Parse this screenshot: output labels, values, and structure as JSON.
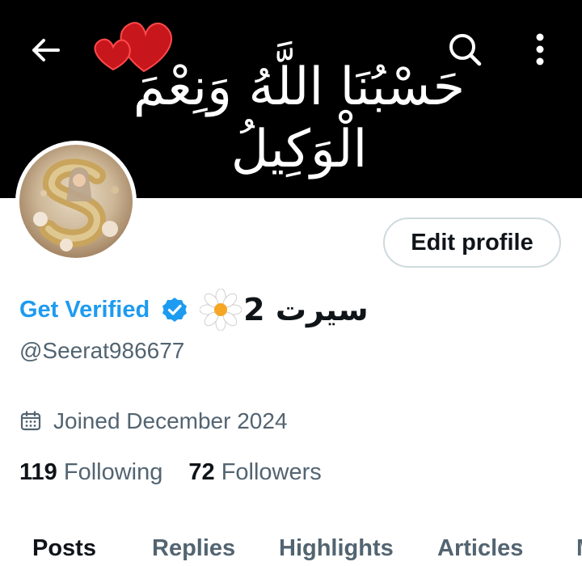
{
  "header": {
    "banner_text": "حَسْبُنَا اللَّهُ وَنِعْمَ الْوَكِيلُ",
    "back_icon": "back-arrow-icon",
    "search_icon": "search-icon",
    "more_icon": "more-vertical-icon"
  },
  "profile": {
    "edit_button": "Edit profile",
    "get_verified": "Get Verified",
    "display_name": "سیرت 2",
    "handle": "@Seerat986677",
    "joined": "Joined December 2024",
    "following_count": "119",
    "following_label": "Following",
    "followers_count": "72",
    "followers_label": "Followers"
  },
  "tabs": [
    {
      "label": "Posts",
      "active": true
    },
    {
      "label": "Replies",
      "active": false
    },
    {
      "label": "Highlights",
      "active": false
    },
    {
      "label": "Articles",
      "active": false
    },
    {
      "label": "M",
      "active": false
    }
  ],
  "colors": {
    "accent": "#1d9bf0",
    "text_primary": "#0f1419",
    "text_secondary": "#536471",
    "banner_bg": "#000000",
    "heart": "#c8161d"
  }
}
